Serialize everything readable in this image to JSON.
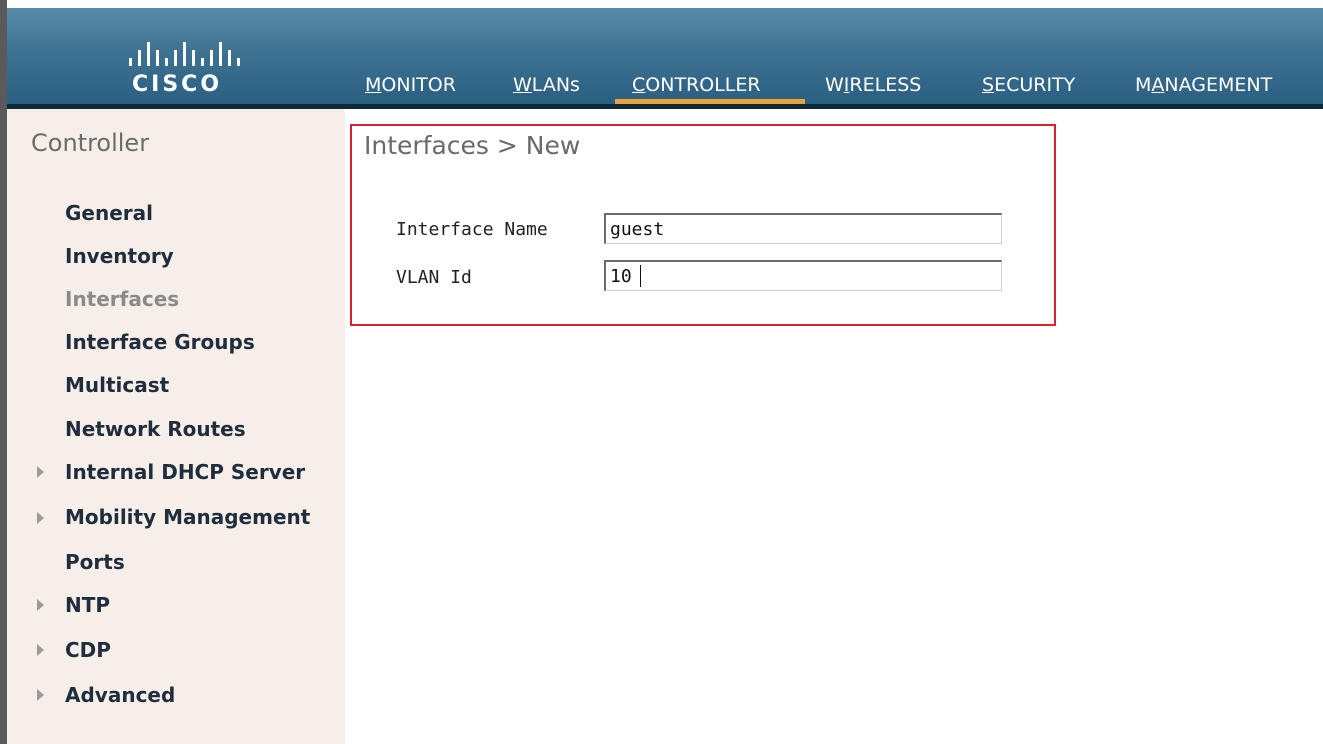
{
  "brand": {
    "logo_text": "CISCO"
  },
  "nav": {
    "items": [
      {
        "pre": "",
        "u": "M",
        "post": "ONITOR"
      },
      {
        "pre": "",
        "u": "W",
        "post": "LANs"
      },
      {
        "pre": "",
        "u": "C",
        "post": "ONTROLLER"
      },
      {
        "pre": "W",
        "u": "I",
        "post": "RELESS"
      },
      {
        "pre": "",
        "u": "S",
        "post": "ECURITY"
      },
      {
        "pre": "M",
        "u": "A",
        "post": "NAGEMENT"
      }
    ],
    "active": "CONTROLLER"
  },
  "sidebar": {
    "title": "Controller",
    "items": [
      {
        "label": "General",
        "expandable": false,
        "active": false
      },
      {
        "label": "Inventory",
        "expandable": false,
        "active": false
      },
      {
        "label": "Interfaces",
        "expandable": false,
        "active": true
      },
      {
        "label": "Interface Groups",
        "expandable": false,
        "active": false
      },
      {
        "label": "Multicast",
        "expandable": false,
        "active": false
      },
      {
        "label": "Network Routes",
        "expandable": false,
        "active": false
      },
      {
        "label": "Internal DHCP Server",
        "expandable": true,
        "active": false
      },
      {
        "label": "Mobility Management",
        "expandable": true,
        "active": false
      },
      {
        "label": "Ports",
        "expandable": false,
        "active": false
      },
      {
        "label": "NTP",
        "expandable": true,
        "active": false
      },
      {
        "label": "CDP",
        "expandable": true,
        "active": false
      },
      {
        "label": "Advanced",
        "expandable": true,
        "active": false
      }
    ]
  },
  "main": {
    "title": "Interfaces > New",
    "fields": {
      "interface_name": {
        "label": "Interface Name",
        "value": "guest"
      },
      "vlan_id": {
        "label": "VLAN Id",
        "value": "10"
      }
    }
  },
  "colors": {
    "header": "#3e7292",
    "active_tab": "#e8a23a",
    "sidebar_bg": "#f6efe9",
    "highlight_box": "#d9242f"
  }
}
